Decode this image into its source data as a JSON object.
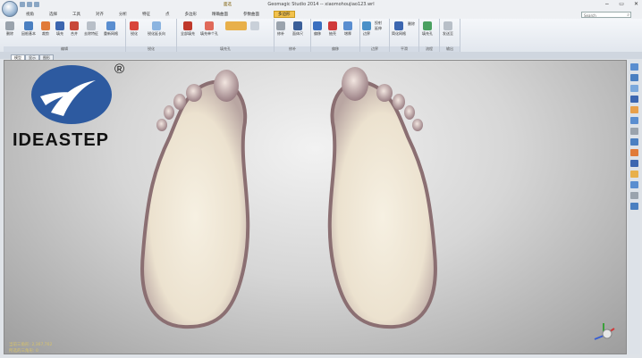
{
  "window": {
    "title": "Geomagic Studio 2014 -- xiaomohoujiao123.wrl",
    "context_tab": "面选",
    "controls": [
      "−",
      "▭",
      "✕"
    ]
  },
  "menu": {
    "tabs": [
      "视角",
      "选择",
      "工具",
      "对齐",
      "分析",
      "特征",
      "点",
      "多边形",
      "精确曲面",
      "参数曲面"
    ],
    "active_tab": "多边形"
  },
  "search": {
    "placeholder": "Search"
  },
  "ribbon": {
    "groups": [
      {
        "label": "编辑",
        "tools": [
          "删除",
          "因根基本",
          "裁剪",
          "填充",
          "合并",
          "去除特征",
          "重新网格"
        ]
      },
      {
        "label": "锐化",
        "tools": [
          "锐化",
          "锐化延长向"
        ]
      },
      {
        "label": "填充孔",
        "tools": [
          "全部填充",
          "填充单个孔"
        ]
      },
      {
        "label": "修补",
        "tools": [
          "修补",
          "面体尺"
        ]
      },
      {
        "label": "偏移",
        "tools": [
          "偏移",
          "抽壳",
          "增厚"
        ]
      },
      {
        "label": "边界",
        "tools": [
          "边界",
          "投射",
          "延伸"
        ]
      },
      {
        "label": "平滑",
        "tools": [
          "简化网格",
          "删除"
        ]
      },
      {
        "label": "流程",
        "tools": [
          "填充孔"
        ]
      },
      {
        "label": "输出",
        "tools": [
          "发送至"
        ]
      }
    ]
  },
  "doc_tabs": [
    "模型",
    "显示",
    "图形"
  ],
  "logo": {
    "text": "IDEASTEP",
    "reg": "®"
  },
  "status": {
    "triangles": "当前三角形: 2,367,762",
    "selected": "所选的三角形: 0"
  },
  "colors": {
    "viewport_center": "#f2f2f2",
    "viewport_edge": "#9d9d9d",
    "logo_blue": "#2d5aa0",
    "foot_inner": "#f4ede0",
    "foot_rim": "#8b6f72"
  },
  "icons": [
    "app-orb-icon",
    "save-icon",
    "undo-icon",
    "redo-icon",
    "search-icon",
    "axis-triad-icon"
  ]
}
